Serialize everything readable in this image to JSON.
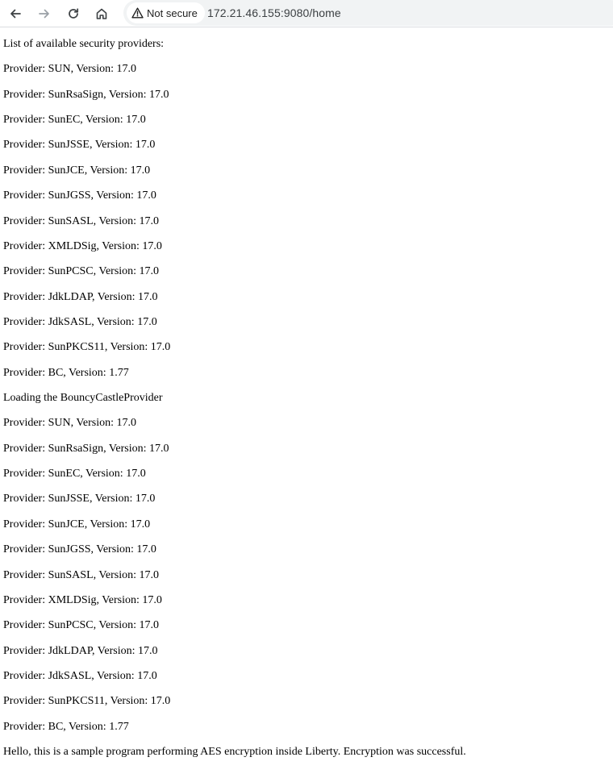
{
  "browser": {
    "security_label": "Not secure",
    "url": "172.21.46.155:9080/home",
    "icons": [
      "back-icon",
      "forward-icon",
      "reload-icon",
      "home-icon",
      "warning-icon"
    ]
  },
  "page": {
    "lines": [
      "List of available security providers:",
      "Provider: SUN, Version: 17.0",
      "Provider: SunRsaSign, Version: 17.0",
      "Provider: SunEC, Version: 17.0",
      "Provider: SunJSSE, Version: 17.0",
      "Provider: SunJCE, Version: 17.0",
      "Provider: SunJGSS, Version: 17.0",
      "Provider: SunSASL, Version: 17.0",
      "Provider: XMLDSig, Version: 17.0",
      "Provider: SunPCSC, Version: 17.0",
      "Provider: JdkLDAP, Version: 17.0",
      "Provider: JdkSASL, Version: 17.0",
      "Provider: SunPKCS11, Version: 17.0",
      "Provider: BC, Version: 1.77",
      "Loading the BouncyCastleProvider",
      "Provider: SUN, Version: 17.0",
      "Provider: SunRsaSign, Version: 17.0",
      "Provider: SunEC, Version: 17.0",
      "Provider: SunJSSE, Version: 17.0",
      "Provider: SunJCE, Version: 17.0",
      "Provider: SunJGSS, Version: 17.0",
      "Provider: SunSASL, Version: 17.0",
      "Provider: XMLDSig, Version: 17.0",
      "Provider: SunPCSC, Version: 17.0",
      "Provider: JdkLDAP, Version: 17.0",
      "Provider: JdkSASL, Version: 17.0",
      "Provider: SunPKCS11, Version: 17.0",
      "Provider: BC, Version: 1.77",
      "Hello, this is a sample program performing AES encryption inside Liberty. Encryption was successful."
    ]
  }
}
